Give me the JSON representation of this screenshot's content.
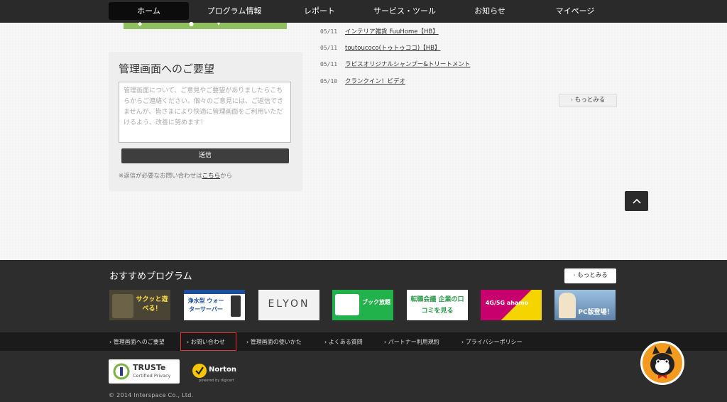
{
  "nav": {
    "items": [
      {
        "label": "ホーム"
      },
      {
        "label": "プログラム情報"
      },
      {
        "label": "レポート"
      },
      {
        "label": "サービス・ツール"
      },
      {
        "label": "お知らせ"
      },
      {
        "label": "マイページ"
      }
    ]
  },
  "feedback": {
    "title": "管理画面へのご要望",
    "placeholder": "管理画面について、ご意見やご要望がありましたらこちらからご連絡ください。個々のご意見には、ご返信できませんが、皆さまにより快適に管理画面をご利用いただけるよう、改善に努めます！",
    "submit_label": "送信",
    "note_prefix": "※返信が必要なお問い合わせは",
    "note_link": "こちら",
    "note_suffix": "から"
  },
  "news": {
    "items": [
      {
        "date": "05/11",
        "title": "インテリア雑貨 FuuHome【HB】"
      },
      {
        "date": "05/11",
        "title": "toutoucoco(トゥトゥココ)【HB】"
      },
      {
        "date": "05/11",
        "title": "ラピスオリジナルシャンプー&トリートメント"
      },
      {
        "date": "05/10",
        "title": "クランクイン！ビデオ"
      }
    ],
    "more_label": "もっとみる"
  },
  "recommended": {
    "title": "おすすめプログラム",
    "more_label": "もっとみる",
    "banners": [
      {
        "text": "サクッと遊べる！",
        "bg": "#4a4434",
        "fg": "#ffe04a"
      },
      {
        "text": "浄水型 ウォーターサーバー",
        "bg": "#ffffff",
        "fg": "#1a4f9c"
      },
      {
        "text": "ELYON",
        "bg": "#f2f2f2",
        "fg": "#444444"
      },
      {
        "text": "ブック放題",
        "bg": "#22b24c",
        "fg": "#ffffff"
      },
      {
        "text": "転職会議 企業の口コミを見る",
        "bg": "#ffffff",
        "fg": "#2b9a4a"
      },
      {
        "text": "4G/5G ahamo",
        "bg": "#c8006e",
        "fg": "#ffffff"
      },
      {
        "text": "PC版登場！",
        "bg": "#7aa0c8",
        "fg": "#ffffff"
      }
    ]
  },
  "footer_links": [
    {
      "label": "管理画面へのご要望"
    },
    {
      "label": "お問い合わせ"
    },
    {
      "label": "管理画面の使いかた"
    },
    {
      "label": "よくある質問"
    },
    {
      "label": "パートナー利用規約"
    },
    {
      "label": "プライバシーポリシー"
    }
  ],
  "badges": {
    "truste_title": "TRUSTe",
    "truste_sub": "Certified Privacy",
    "norton_title": "Norton",
    "norton_sub": "powered by digicert"
  },
  "copyright": "© 2014 Interspace Co., Ltd.",
  "colors": {
    "nav_bg": "#2a2a2a",
    "footer_bg": "#2d2d2d",
    "highlight": "#e2362c",
    "mascot_bg": "#f49a1f"
  }
}
